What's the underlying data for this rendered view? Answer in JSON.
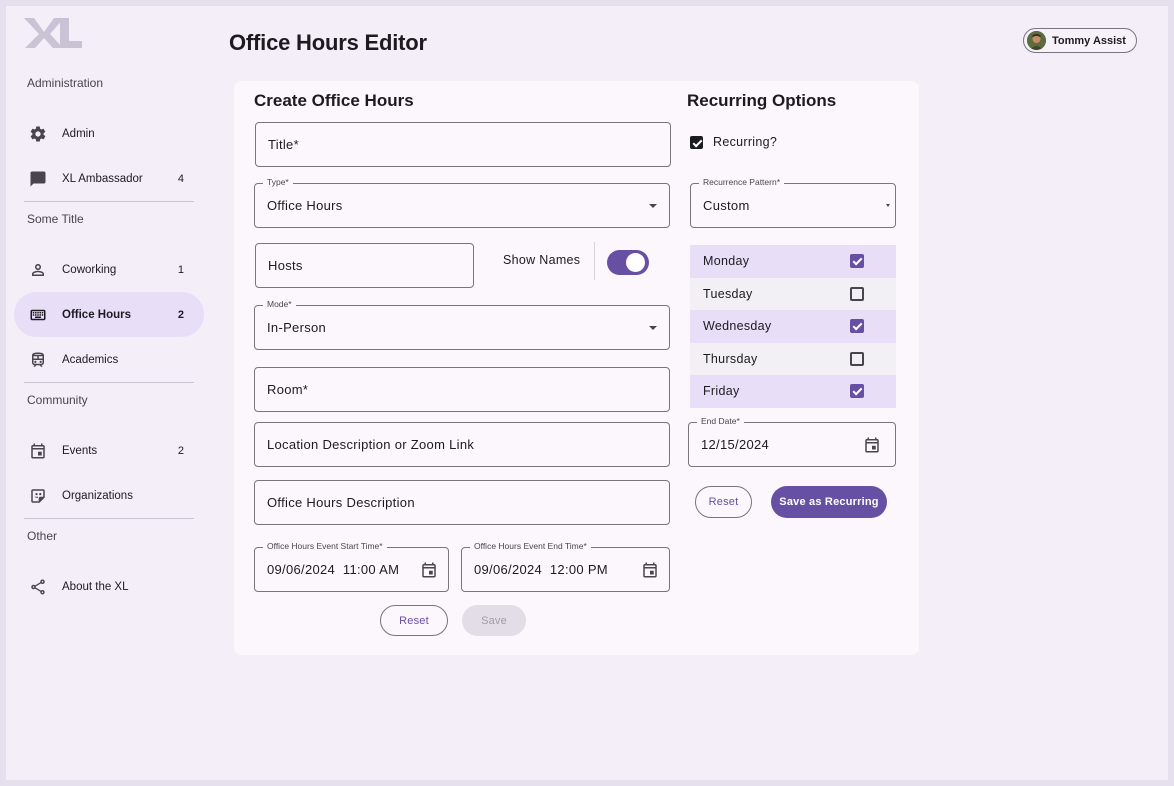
{
  "app": {
    "page_title": "Office Hours Editor",
    "user_name": "Tommy Assist"
  },
  "sidebar": {
    "sections": [
      {
        "title": "Administration",
        "items": [
          {
            "label": "Admin",
            "badge": "",
            "icon": "gear-icon"
          },
          {
            "label": "XL Ambassador",
            "badge": "4",
            "icon": "chat-icon"
          }
        ]
      },
      {
        "title": "Some Title",
        "items": [
          {
            "label": "Coworking",
            "badge": "1",
            "icon": "person-icon"
          },
          {
            "label": "Office Hours",
            "badge": "2",
            "icon": "keyboard-icon",
            "active": true
          },
          {
            "label": "Academics",
            "badge": "",
            "icon": "bus-icon"
          }
        ]
      },
      {
        "title": "Community",
        "items": [
          {
            "label": "Events",
            "badge": "2",
            "icon": "calendar-icon"
          },
          {
            "label": "Organizations",
            "badge": "",
            "icon": "emoji-icon"
          }
        ]
      },
      {
        "title": "Other",
        "items": [
          {
            "label": "About the XL",
            "badge": "",
            "icon": "share-icon"
          }
        ]
      }
    ]
  },
  "form": {
    "title": "Create Office Hours",
    "title_placeholder": "Title*",
    "type_label": "Type*",
    "type_value": "Office Hours",
    "hosts_placeholder": "Hosts",
    "show_names_label": "Show Names",
    "mode_label": "Mode*",
    "mode_value": "In-Person",
    "room_placeholder": "Room*",
    "location_placeholder": "Location Description or Zoom Link",
    "description_placeholder": "Office Hours Description",
    "start_label": "Office Hours Event Start Time*",
    "start_value": "09/06/2024  11:00 AM",
    "end_label": "Office Hours Event End Time*",
    "end_value": "09/06/2024  12:00 PM",
    "reset_label": "Reset",
    "save_label": "Save"
  },
  "recurring": {
    "title": "Recurring Options",
    "checkbox_label": "Recurring?",
    "pattern_label": "Recurrence Pattern*",
    "pattern_value": "Custom",
    "days": [
      {
        "name": "Monday",
        "checked": true
      },
      {
        "name": "Tuesday",
        "checked": false
      },
      {
        "name": "Wednesday",
        "checked": true
      },
      {
        "name": "Thursday",
        "checked": false
      },
      {
        "name": "Friday",
        "checked": true
      }
    ],
    "end_date_label": "End Date*",
    "end_date_value": "12/15/2024",
    "reset_label": "Reset",
    "save_label": "Save as Recurring"
  },
  "colors": {
    "primary": "#6750a4",
    "selected_bg": "#e8def8",
    "surface": "#fcf6fd",
    "background": "#f3eef7"
  }
}
